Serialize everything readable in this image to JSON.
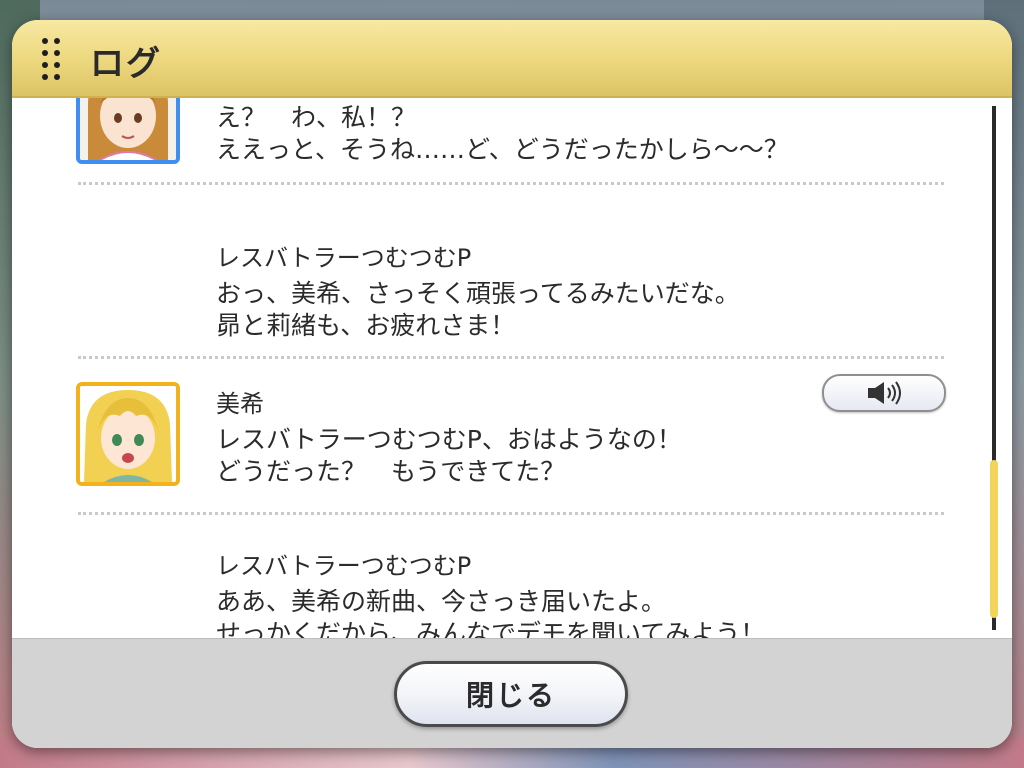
{
  "header": {
    "title": "ログ"
  },
  "entries": [
    {
      "speaker": "",
      "lines": [
        "え？　わ、私！？",
        "ええっと、そうね……ど、どうだったかしら～～？"
      ],
      "avatar": {
        "icon": "character-portrait-brown-hair",
        "frame_color": "#3f8ef0"
      },
      "has_voice": false
    },
    {
      "speaker": "レスバトラーつむつむP",
      "lines": [
        "おっ、美希、さっそく頑張ってるみたいだな。",
        "昴と莉緒も、お疲れさま！"
      ],
      "avatar": null,
      "has_voice": false
    },
    {
      "speaker": "美希",
      "lines": [
        "レスバトラーつむつむP、おはようなの！",
        "どうだった？　もうできてた？"
      ],
      "avatar": {
        "icon": "character-portrait-blonde-hair",
        "frame_color": "#f2b21e"
      },
      "has_voice": true,
      "voice_icon": "speaker-icon"
    },
    {
      "speaker": "レスバトラーつむつむP",
      "lines": [
        "ああ、美希の新曲、今さっき届いたよ。",
        "せっかくだから、みんなでデモを聞いてみよう！"
      ],
      "avatar": null,
      "has_voice": false
    }
  ],
  "scrollbar": {
    "position": "bottom",
    "thumb_color": "#f2d45a"
  },
  "footer": {
    "close_label": "閉じる"
  }
}
